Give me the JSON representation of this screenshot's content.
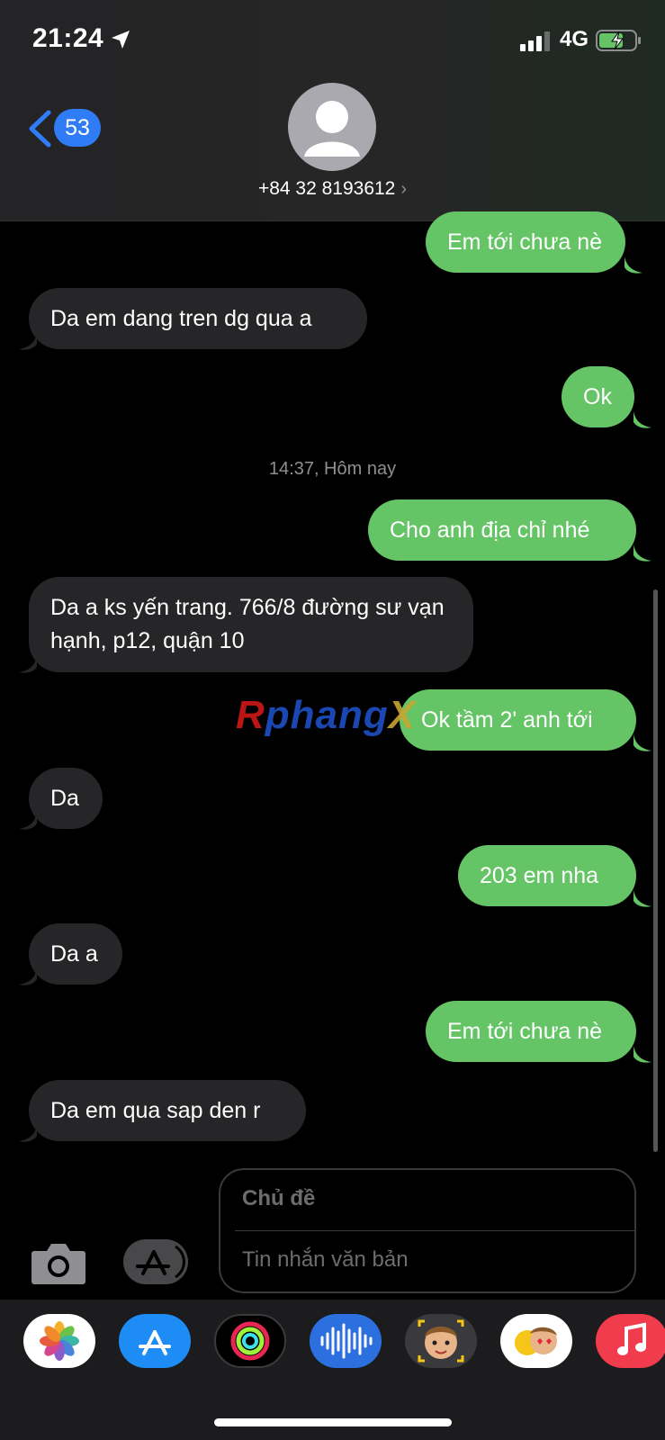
{
  "status_bar": {
    "time": "21:24",
    "network": "4G"
  },
  "header": {
    "back_count": "53",
    "contact": "+84 32 8193612",
    "contact_chevron": "›"
  },
  "conversation": {
    "messages": [
      {
        "dir": "out",
        "text": "Em tới chưa nè"
      },
      {
        "dir": "in",
        "text": "Da em dang tren dg qua a"
      },
      {
        "dir": "out",
        "text": "Ok"
      },
      {
        "dir": "out",
        "text": "Cho anh địa chỉ nhé"
      },
      {
        "dir": "in",
        "text": "Da a ks yến trang. 766/8 đường sư vạn hạnh, p12, quận 10"
      },
      {
        "dir": "out",
        "text": "Ok tầm 2' anh tới"
      },
      {
        "dir": "in",
        "text": "Da"
      },
      {
        "dir": "out",
        "text": "203 em nha"
      },
      {
        "dir": "in",
        "text": "Da a"
      },
      {
        "dir": "out",
        "text": "Em tới chưa nè"
      },
      {
        "dir": "in",
        "text": "Da em qua sap den r"
      }
    ],
    "timestamp": "14:37, Hôm nay"
  },
  "watermark": {
    "part1": "R",
    "part2": "phang",
    "part3": "X"
  },
  "compose": {
    "subject_placeholder": "Chủ đề",
    "message_placeholder": "Tin nhắn văn bản"
  },
  "app_drawer": {
    "apps": [
      "photos-icon",
      "app-store-icon",
      "activity-icon",
      "audio-message-icon",
      "memoji-icon",
      "memoji-stickers-icon",
      "music-icon"
    ]
  },
  "colors": {
    "outgoing": "#65c466",
    "incoming": "#262628",
    "accent": "#2f7cf6"
  }
}
